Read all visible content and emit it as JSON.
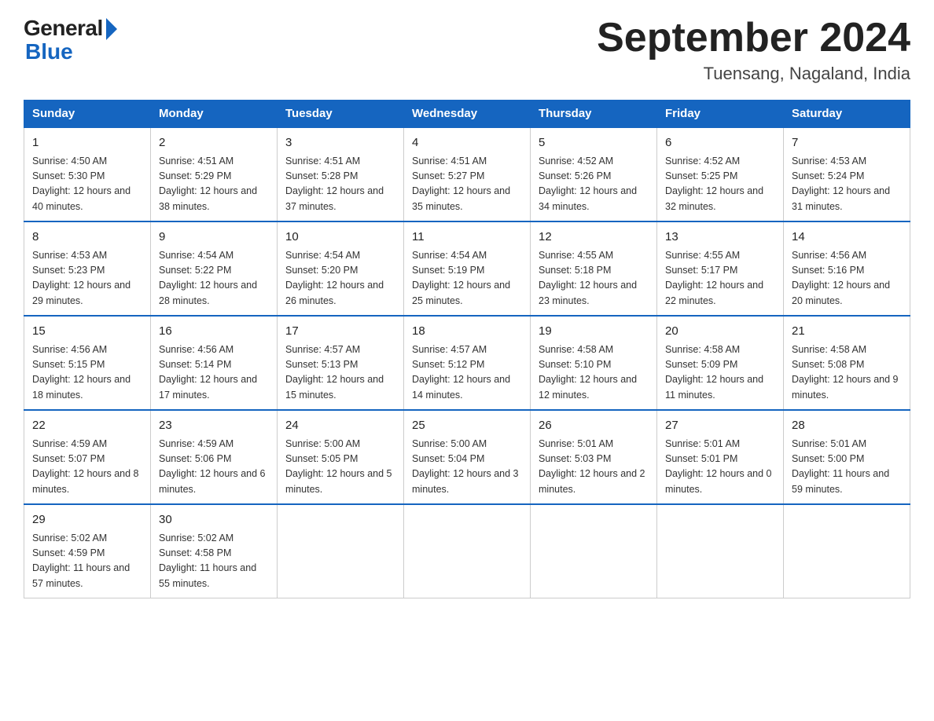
{
  "header": {
    "logo_general": "General",
    "logo_blue": "Blue",
    "month_title": "September 2024",
    "location": "Tuensang, Nagaland, India"
  },
  "days_of_week": [
    "Sunday",
    "Monday",
    "Tuesday",
    "Wednesday",
    "Thursday",
    "Friday",
    "Saturday"
  ],
  "weeks": [
    [
      {
        "day": "1",
        "sunrise": "4:50 AM",
        "sunset": "5:30 PM",
        "daylight": "12 hours and 40 minutes."
      },
      {
        "day": "2",
        "sunrise": "4:51 AM",
        "sunset": "5:29 PM",
        "daylight": "12 hours and 38 minutes."
      },
      {
        "day": "3",
        "sunrise": "4:51 AM",
        "sunset": "5:28 PM",
        "daylight": "12 hours and 37 minutes."
      },
      {
        "day": "4",
        "sunrise": "4:51 AM",
        "sunset": "5:27 PM",
        "daylight": "12 hours and 35 minutes."
      },
      {
        "day": "5",
        "sunrise": "4:52 AM",
        "sunset": "5:26 PM",
        "daylight": "12 hours and 34 minutes."
      },
      {
        "day": "6",
        "sunrise": "4:52 AM",
        "sunset": "5:25 PM",
        "daylight": "12 hours and 32 minutes."
      },
      {
        "day": "7",
        "sunrise": "4:53 AM",
        "sunset": "5:24 PM",
        "daylight": "12 hours and 31 minutes."
      }
    ],
    [
      {
        "day": "8",
        "sunrise": "4:53 AM",
        "sunset": "5:23 PM",
        "daylight": "12 hours and 29 minutes."
      },
      {
        "day": "9",
        "sunrise": "4:54 AM",
        "sunset": "5:22 PM",
        "daylight": "12 hours and 28 minutes."
      },
      {
        "day": "10",
        "sunrise": "4:54 AM",
        "sunset": "5:20 PM",
        "daylight": "12 hours and 26 minutes."
      },
      {
        "day": "11",
        "sunrise": "4:54 AM",
        "sunset": "5:19 PM",
        "daylight": "12 hours and 25 minutes."
      },
      {
        "day": "12",
        "sunrise": "4:55 AM",
        "sunset": "5:18 PM",
        "daylight": "12 hours and 23 minutes."
      },
      {
        "day": "13",
        "sunrise": "4:55 AM",
        "sunset": "5:17 PM",
        "daylight": "12 hours and 22 minutes."
      },
      {
        "day": "14",
        "sunrise": "4:56 AM",
        "sunset": "5:16 PM",
        "daylight": "12 hours and 20 minutes."
      }
    ],
    [
      {
        "day": "15",
        "sunrise": "4:56 AM",
        "sunset": "5:15 PM",
        "daylight": "12 hours and 18 minutes."
      },
      {
        "day": "16",
        "sunrise": "4:56 AM",
        "sunset": "5:14 PM",
        "daylight": "12 hours and 17 minutes."
      },
      {
        "day": "17",
        "sunrise": "4:57 AM",
        "sunset": "5:13 PM",
        "daylight": "12 hours and 15 minutes."
      },
      {
        "day": "18",
        "sunrise": "4:57 AM",
        "sunset": "5:12 PM",
        "daylight": "12 hours and 14 minutes."
      },
      {
        "day": "19",
        "sunrise": "4:58 AM",
        "sunset": "5:10 PM",
        "daylight": "12 hours and 12 minutes."
      },
      {
        "day": "20",
        "sunrise": "4:58 AM",
        "sunset": "5:09 PM",
        "daylight": "12 hours and 11 minutes."
      },
      {
        "day": "21",
        "sunrise": "4:58 AM",
        "sunset": "5:08 PM",
        "daylight": "12 hours and 9 minutes."
      }
    ],
    [
      {
        "day": "22",
        "sunrise": "4:59 AM",
        "sunset": "5:07 PM",
        "daylight": "12 hours and 8 minutes."
      },
      {
        "day": "23",
        "sunrise": "4:59 AM",
        "sunset": "5:06 PM",
        "daylight": "12 hours and 6 minutes."
      },
      {
        "day": "24",
        "sunrise": "5:00 AM",
        "sunset": "5:05 PM",
        "daylight": "12 hours and 5 minutes."
      },
      {
        "day": "25",
        "sunrise": "5:00 AM",
        "sunset": "5:04 PM",
        "daylight": "12 hours and 3 minutes."
      },
      {
        "day": "26",
        "sunrise": "5:01 AM",
        "sunset": "5:03 PM",
        "daylight": "12 hours and 2 minutes."
      },
      {
        "day": "27",
        "sunrise": "5:01 AM",
        "sunset": "5:01 PM",
        "daylight": "12 hours and 0 minutes."
      },
      {
        "day": "28",
        "sunrise": "5:01 AM",
        "sunset": "5:00 PM",
        "daylight": "11 hours and 59 minutes."
      }
    ],
    [
      {
        "day": "29",
        "sunrise": "5:02 AM",
        "sunset": "4:59 PM",
        "daylight": "11 hours and 57 minutes."
      },
      {
        "day": "30",
        "sunrise": "5:02 AM",
        "sunset": "4:58 PM",
        "daylight": "11 hours and 55 minutes."
      },
      null,
      null,
      null,
      null,
      null
    ]
  ],
  "labels": {
    "sunrise_prefix": "Sunrise: ",
    "sunset_prefix": "Sunset: ",
    "daylight_prefix": "Daylight: "
  }
}
